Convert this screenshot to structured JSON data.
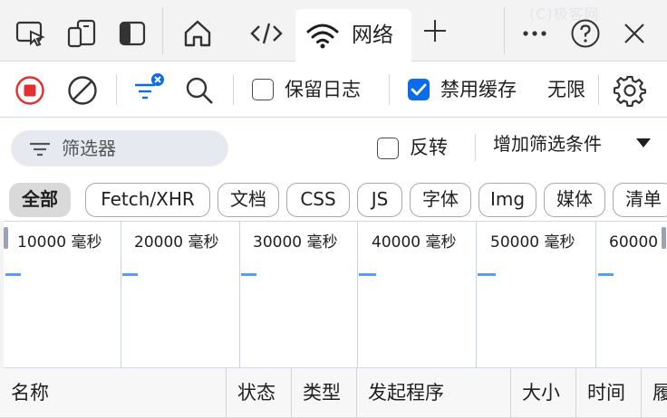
{
  "tabs": {
    "icons": [
      "inspect-icon",
      "device-emulation-icon",
      "sidebar-toggle-icon",
      "home-icon",
      "sources-icon"
    ],
    "active_label": "网络",
    "active_icon": "wifi-icon",
    "add_icon": "plus-icon",
    "more_icon": "more-icon",
    "help_icon": "help-icon",
    "close_icon": "close-icon",
    "watermark": "(C)极客网"
  },
  "toolbar": {
    "record_icon": "record-stop-icon",
    "clear_icon": "clear-icon",
    "filter_icon": "filter-active-icon",
    "search_icon": "search-icon",
    "preserve_log_label": "保留日志",
    "preserve_log_checked": false,
    "disable_cache_label": "禁用缓存",
    "disable_cache_checked": true,
    "throttling_label": "无限",
    "settings_icon": "gear-icon"
  },
  "filter": {
    "placeholder": "筛选器",
    "invert_label": "反转",
    "invert_checked": false,
    "add_filter_label": "增加筛选条件"
  },
  "types": [
    {
      "label": "全部",
      "active": true
    },
    {
      "label": "Fetch/XHR",
      "active": false
    },
    {
      "label": "文档",
      "active": false
    },
    {
      "label": "CSS",
      "active": false
    },
    {
      "label": "JS",
      "active": false
    },
    {
      "label": "字体",
      "active": false
    },
    {
      "label": "Img",
      "active": false
    },
    {
      "label": "媒体",
      "active": false
    },
    {
      "label": "清单",
      "active": false
    }
  ],
  "timeline": {
    "ticks": [
      "10000  毫秒",
      "20000  毫秒",
      "30000  毫秒",
      "40000  毫秒",
      "50000  毫秒",
      "60000"
    ]
  },
  "columns": [
    "名称",
    "状态",
    "类型",
    "发起程序",
    "大小",
    "时间",
    "履"
  ],
  "colors": {
    "accent": "#0a6ce8",
    "record": "#e03030",
    "timeline_bar": "#5b9bf0"
  }
}
